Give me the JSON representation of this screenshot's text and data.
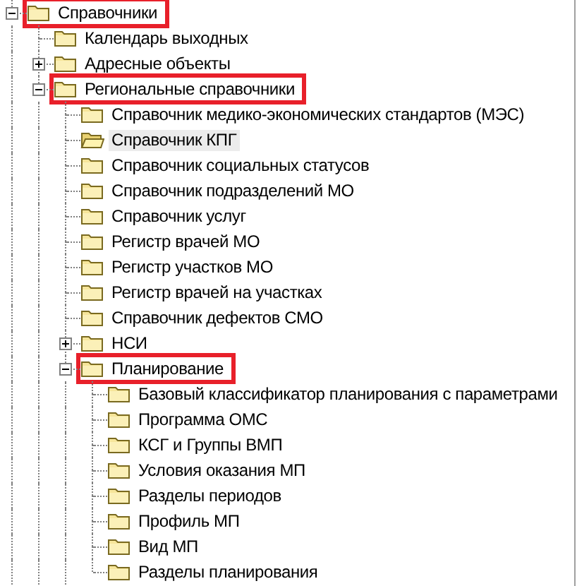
{
  "tree": [
    {
      "label": "Справочники",
      "expanded": true,
      "selected": false,
      "highlighted": true,
      "children": [
        {
          "label": "Календарь выходных",
          "selected": false,
          "highlighted": false
        },
        {
          "label": "Адресные объекты",
          "expanded": false,
          "selected": false,
          "highlighted": false
        },
        {
          "label": "Региональные справочники",
          "expanded": true,
          "selected": false,
          "highlighted": true,
          "children": [
            {
              "label": "Справочник медико-экономических стандартов (МЭС)",
              "selected": false,
              "highlighted": false
            },
            {
              "label": "Справочник КПГ",
              "selected": true,
              "highlighted": false
            },
            {
              "label": "Справочник социальных статусов",
              "selected": false,
              "highlighted": false
            },
            {
              "label": "Справочник подразделений МО",
              "selected": false,
              "highlighted": false
            },
            {
              "label": "Справочник услуг",
              "selected": false,
              "highlighted": false
            },
            {
              "label": "Регистр врачей МО",
              "selected": false,
              "highlighted": false
            },
            {
              "label": "Регистр участков МО",
              "selected": false,
              "highlighted": false
            },
            {
              "label": "Регистр врачей на участках",
              "selected": false,
              "highlighted": false
            },
            {
              "label": "Справочник дефектов СМО",
              "selected": false,
              "highlighted": false
            },
            {
              "label": "НСИ",
              "expanded": false,
              "selected": false,
              "highlighted": false
            },
            {
              "label": "Планирование",
              "expanded": true,
              "selected": false,
              "highlighted": true,
              "children": [
                {
                  "label": "Базовый классификатор планирования с параметрами",
                  "selected": false,
                  "highlighted": false
                },
                {
                  "label": "Программа ОМС",
                  "selected": false,
                  "highlighted": false
                },
                {
                  "label": "КСГ и Группы ВМП",
                  "selected": false,
                  "highlighted": false
                },
                {
                  "label": "Условия оказания МП",
                  "selected": false,
                  "highlighted": false
                },
                {
                  "label": "Разделы периодов",
                  "selected": false,
                  "highlighted": false
                },
                {
                  "label": "Профиль МП",
                  "selected": false,
                  "highlighted": false
                },
                {
                  "label": "Вид МП",
                  "selected": false,
                  "highlighted": false
                },
                {
                  "label": "Разделы планирования",
                  "selected": false,
                  "highlighted": false
                }
              ]
            }
          ]
        }
      ]
    }
  ]
}
